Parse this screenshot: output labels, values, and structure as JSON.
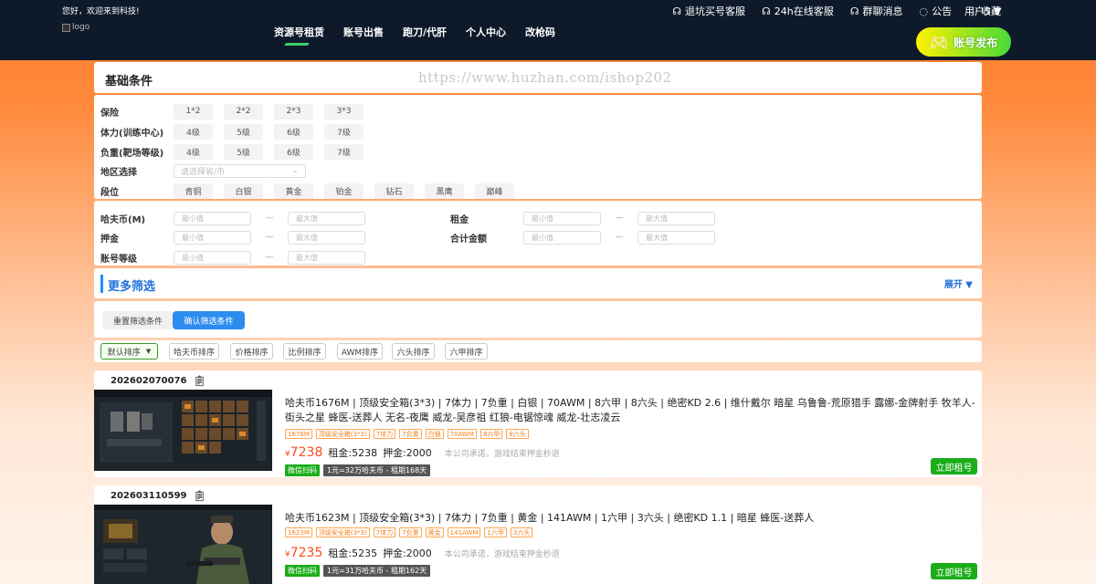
{
  "header": {
    "welcome": "您好，欢迎来到科技!",
    "logo_alt": "logo",
    "top_links": [
      {
        "icon": "headset-icon",
        "label": "退坑买号客服"
      },
      {
        "icon": "headset-icon",
        "label": "24h在线客服"
      },
      {
        "icon": "headset-icon",
        "label": "群聊消息"
      },
      {
        "icon": "chat-icon",
        "label": "公告"
      },
      {
        "icon": "heart-icon",
        "label": "收藏"
      }
    ],
    "user": "用户5",
    "nav": [
      "资源号租赁",
      "账号出售",
      "跑刀/代肝",
      "个人中心",
      "改枪码"
    ],
    "publish": "账号发布"
  },
  "basic": {
    "title": "基础条件",
    "watermark": "https://www.huzhan.com/ishop202"
  },
  "filters": {
    "insurance": {
      "label": "保险",
      "options": [
        "1*2",
        "2*2",
        "2*3",
        "3*3"
      ]
    },
    "stamina": {
      "label": "体力(训练中心)",
      "options": [
        "4级",
        "5级",
        "6级",
        "7级"
      ]
    },
    "load": {
      "label": "负重(靶场等级)",
      "options": [
        "4级",
        "5级",
        "6级",
        "7级"
      ]
    },
    "region": {
      "label": "地区选择",
      "placeholder": "请选择省/市"
    },
    "rank": {
      "label": "段位",
      "options": [
        "青铜",
        "白银",
        "黄金",
        "铂金",
        "钻石",
        "黑鹰",
        "巅峰"
      ]
    }
  },
  "ranges": {
    "min_placeholder": "最小值",
    "max_placeholder": "最大值",
    "dash": "—",
    "hafu": "哈夫币(M)",
    "rent": "租金",
    "deposit": "押金",
    "total": "合计金额",
    "level": "账号等级"
  },
  "more": {
    "title": "更多筛选",
    "expand": "展开 ▼"
  },
  "actions": {
    "reset": "重置筛选条件",
    "confirm": "确认筛选条件"
  },
  "sort": {
    "default": "默认排序",
    "options": [
      "哈夫币排序",
      "价格排序",
      "比例排序",
      "AWM排序",
      "六头排序",
      "六甲排序"
    ]
  },
  "listings": [
    {
      "id": "202602070076",
      "title": "哈夫币1676M | 顶级安全箱(3*3) | 7体力 | 7负重 | 白银 | 70AWM | 8六甲 | 8六头 | 绝密KD 2.6 | 维什戴尔 暗星 乌鲁鲁-荒原猎手 露娜-金牌射手 牧羊人-街头之星 蜂医-送葬人 无名-夜鹰 威龙-吴彦祖 红狼-电锯惊魂 威龙-壮志凌云",
      "tags": [
        "1676M",
        "顶级安全箱(3*3)",
        "7体力",
        "7负重",
        "白银",
        "70AWM",
        "8六甲",
        "8六头"
      ],
      "price": "7238",
      "rent": "租金:5238",
      "deposit": "押金:2000",
      "promise": "本公司承诺，游戏结束押金秒退",
      "wechat": "微信扫码",
      "rate": "1元=32万哈夫币 - 租期168天",
      "button": "立即租号"
    },
    {
      "id": "202603110599",
      "title": "哈夫币1623M | 顶级安全箱(3*3) | 7体力 | 7负重 | 黄金 | 141AWM | 1六甲 | 3六头 | 绝密KD 1.1 | 暗星 蜂医-送葬人",
      "tags": [
        "1623M",
        "顶级安全箱(3*3)",
        "7体力",
        "7负重",
        "黄金",
        "141AWM",
        "1六甲",
        "3六头"
      ],
      "price": "7235",
      "rent": "租金:5235",
      "deposit": "押金:2000",
      "promise": "本公司承诺，游戏结束押金秒退",
      "wechat": "微信扫码",
      "rate": "1元=31万哈夫币 - 租期162天",
      "button": "立即租号"
    }
  ],
  "currency_symbol": "¥",
  "colors": {
    "header_bg": "#0e1a2a",
    "accent_blue": "#2d8cf0",
    "price_red": "#ff4a1a",
    "green": "#1aad19",
    "tag_orange": "#f7821c"
  }
}
